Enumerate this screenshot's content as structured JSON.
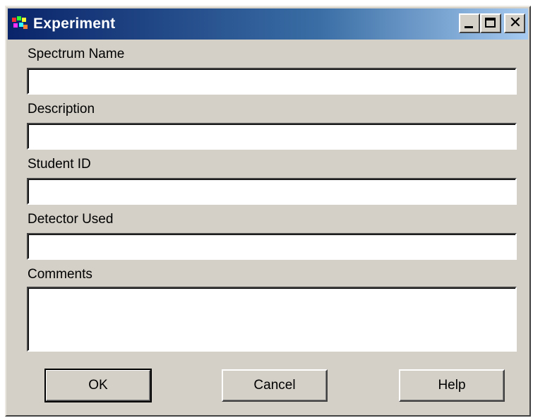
{
  "window": {
    "title": "Experiment",
    "icon": "app-icon"
  },
  "titlebar_buttons": {
    "minimize": "minimize-icon",
    "maximize": "maximize-icon",
    "close": "close-icon",
    "close_glyph": "✕"
  },
  "fields": {
    "spectrum_name": {
      "label": "Spectrum Name",
      "value": ""
    },
    "description": {
      "label": "Description",
      "value": ""
    },
    "student_id": {
      "label": "Student ID",
      "value": ""
    },
    "detector_used": {
      "label": "Detector Used",
      "value": ""
    },
    "comments": {
      "label": "Comments",
      "value": ""
    }
  },
  "buttons": {
    "ok": "OK",
    "cancel": "Cancel",
    "help": "Help"
  },
  "colors": {
    "titlebar_start": "#0a246a",
    "titlebar_end": "#a6caf0",
    "face": "#d4d0c8"
  }
}
